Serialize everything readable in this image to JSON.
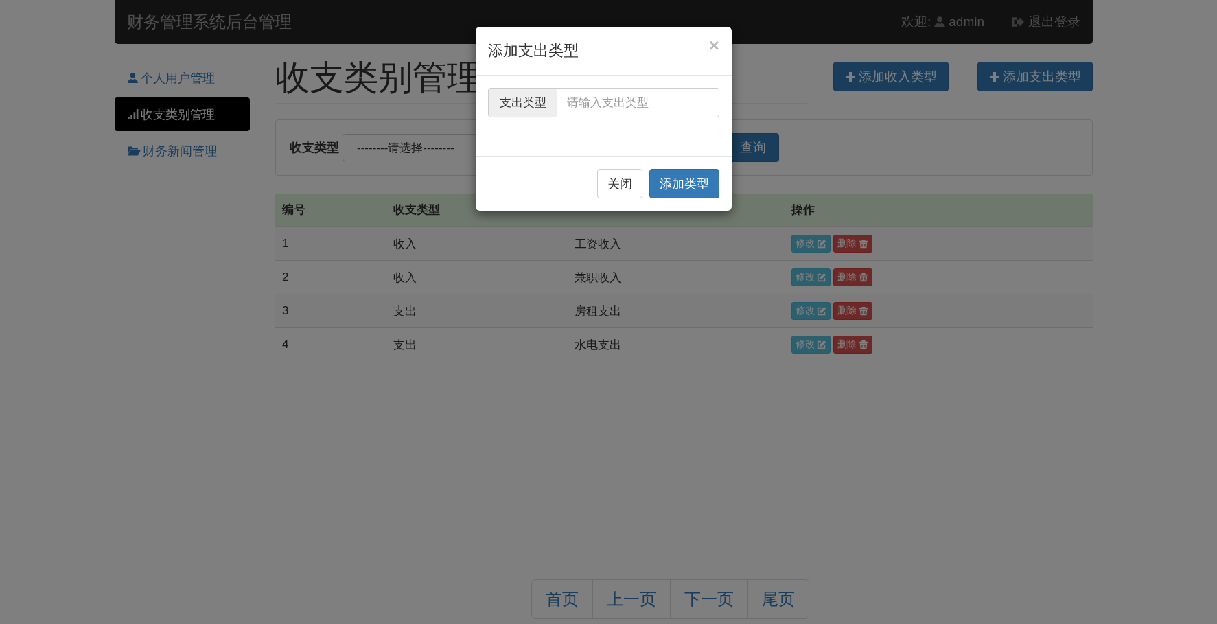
{
  "navbar": {
    "brand": "财务管理系统后台管理",
    "welcome": "欢迎:",
    "user": "admin",
    "logout": "退出登录"
  },
  "sidebar": {
    "items": [
      {
        "label": "个人用户管理",
        "selected": false
      },
      {
        "label": "收支类别管理",
        "selected": true
      },
      {
        "label": "财务新闻管理",
        "selected": false
      }
    ]
  },
  "page": {
    "title": "收支类别管理",
    "actions": [
      "添加收入类型",
      "添加支出类型"
    ]
  },
  "filter": {
    "label": "收支类型",
    "select_value": "--------请选择--------",
    "button": "查询"
  },
  "table": {
    "columns": [
      {
        "label": "编号"
      },
      {
        "label": "收支类型"
      },
      {},
      {
        "label": "操作"
      }
    ],
    "rows": [
      {
        "id": "1",
        "type": "收入",
        "subtype": "工资收入",
        "actions": [
          {
            "label": "修改",
            "kind": "edit"
          },
          {
            "label": "删除",
            "kind": "delete"
          }
        ]
      },
      {
        "id": "2",
        "type": "收入",
        "subtype": "兼职收入",
        "actions": [
          {
            "label": "修改",
            "kind": "edit"
          },
          {
            "label": "删除",
            "kind": "delete"
          }
        ]
      },
      {
        "id": "3",
        "type": "支出",
        "subtype": "房租支出",
        "actions": [
          {
            "label": "修改",
            "kind": "edit"
          },
          {
            "label": "删除",
            "kind": "delete"
          }
        ]
      },
      {
        "id": "4",
        "type": "支出",
        "subtype": "水电支出",
        "actions": [
          {
            "label": "修改",
            "kind": "edit"
          },
          {
            "label": "删除",
            "kind": "delete"
          }
        ]
      }
    ]
  },
  "pagination": [
    "首页",
    "上一页",
    "下一页",
    "尾页"
  ],
  "modal": {
    "title": "添加支出类型",
    "close": "×",
    "field_label": "支出类型",
    "placeholder": "请输入支出类型",
    "buttons": [
      {
        "label": "关闭",
        "kind": "default"
      },
      {
        "label": "添加类型",
        "kind": "primary"
      }
    ]
  }
}
